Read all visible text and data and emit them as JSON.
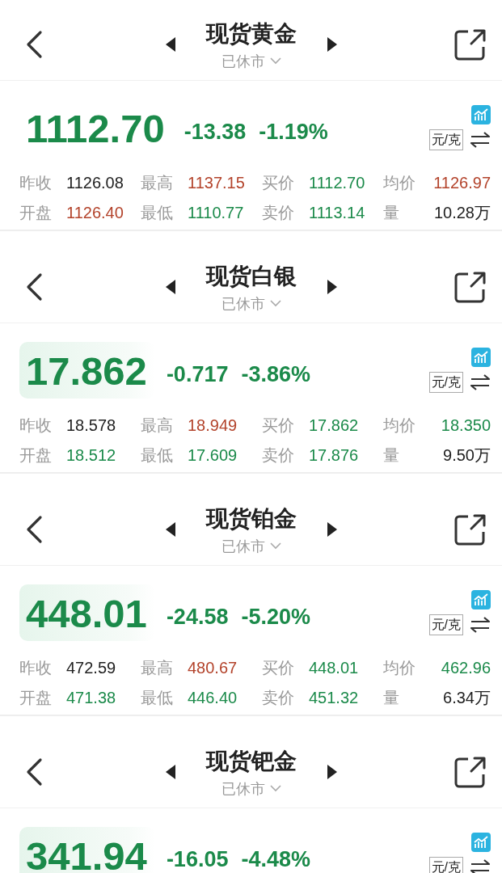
{
  "panels": [
    {
      "title": "现货黄金",
      "status": "已休市",
      "price": "1112.70",
      "change": "-13.38",
      "percent": "-1.19%",
      "color": "#1b8a4a",
      "highlight": false,
      "unit": "元/克",
      "stats": [
        {
          "label": "昨收",
          "value": "1126.08",
          "color": "#222222"
        },
        {
          "label": "最高",
          "value": "1137.15",
          "color": "#b3432b"
        },
        {
          "label": "买价",
          "value": "1112.70",
          "color": "#1b8a4a"
        },
        {
          "label": "均价",
          "value": "1126.97",
          "color": "#b3432b"
        },
        {
          "label": "开盘",
          "value": "1126.40",
          "color": "#b3432b"
        },
        {
          "label": "最低",
          "value": "1110.77",
          "color": "#1b8a4a"
        },
        {
          "label": "卖价",
          "value": "1113.14",
          "color": "#1b8a4a"
        },
        {
          "label": "量",
          "value": "10.28万",
          "color": "#222222"
        }
      ]
    },
    {
      "title": "现货白银",
      "status": "已休市",
      "price": "17.862",
      "change": "-0.717",
      "percent": "-3.86%",
      "color": "#1b8a4a",
      "highlight": true,
      "unit": "元/克",
      "stats": [
        {
          "label": "昨收",
          "value": "18.578",
          "color": "#222222"
        },
        {
          "label": "最高",
          "value": "18.949",
          "color": "#b3432b"
        },
        {
          "label": "买价",
          "value": "17.862",
          "color": "#1b8a4a"
        },
        {
          "label": "均价",
          "value": "18.350",
          "color": "#1b8a4a"
        },
        {
          "label": "开盘",
          "value": "18.512",
          "color": "#1b8a4a"
        },
        {
          "label": "最低",
          "value": "17.609",
          "color": "#1b8a4a"
        },
        {
          "label": "卖价",
          "value": "17.876",
          "color": "#1b8a4a"
        },
        {
          "label": "量",
          "value": "9.50万",
          "color": "#222222"
        }
      ]
    },
    {
      "title": "现货铂金",
      "status": "已休市",
      "price": "448.01",
      "change": "-24.58",
      "percent": "-5.20%",
      "color": "#1b8a4a",
      "highlight": true,
      "unit": "元/克",
      "stats": [
        {
          "label": "昨收",
          "value": "472.59",
          "color": "#222222"
        },
        {
          "label": "最高",
          "value": "480.67",
          "color": "#b3432b"
        },
        {
          "label": "买价",
          "value": "448.01",
          "color": "#1b8a4a"
        },
        {
          "label": "均价",
          "value": "462.96",
          "color": "#1b8a4a"
        },
        {
          "label": "开盘",
          "value": "471.38",
          "color": "#1b8a4a"
        },
        {
          "label": "最低",
          "value": "446.40",
          "color": "#1b8a4a"
        },
        {
          "label": "卖价",
          "value": "451.32",
          "color": "#1b8a4a"
        },
        {
          "label": "量",
          "value": "6.34万",
          "color": "#222222"
        }
      ]
    },
    {
      "title": "现货钯金",
      "status": "已休市",
      "price": "341.94",
      "change": "-16.05",
      "percent": "-4.48%",
      "color": "#1b8a4a",
      "highlight": true,
      "unit": "元/克"
    }
  ]
}
